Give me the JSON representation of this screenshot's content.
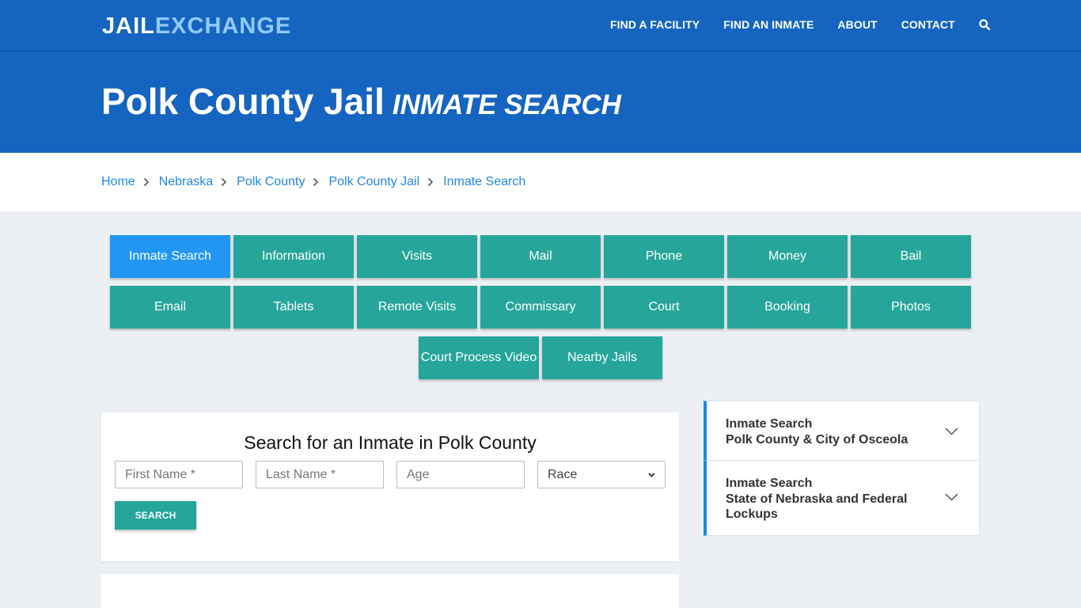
{
  "brand": {
    "logo_part1": "JAIL",
    "logo_part2": "EXCHANGE"
  },
  "nav": {
    "items": [
      "FIND A FACILITY",
      "FIND AN INMATE",
      "ABOUT",
      "CONTACT"
    ],
    "search_icon": "search-icon"
  },
  "hero": {
    "title": "Polk County Jail",
    "subtitle": "INMATE SEARCH"
  },
  "breadcrumb": [
    "Home",
    "Nebraska",
    "Polk County",
    "Polk County Jail",
    "Inmate Search"
  ],
  "tabs": {
    "row1": [
      "Inmate Search",
      "Information",
      "Visits",
      "Mail",
      "Phone",
      "Money",
      "Bail"
    ],
    "row2": [
      "Email",
      "Tablets",
      "Remote Visits",
      "Commissary",
      "Court",
      "Booking",
      "Photos"
    ],
    "row3": [
      "Court Process Video",
      "Nearby Jails"
    ],
    "active": "Inmate Search"
  },
  "search": {
    "heading": "Search for an Inmate in Polk County",
    "first_name_placeholder": "First Name *",
    "last_name_placeholder": "Last Name *",
    "age_placeholder": "Age",
    "race_selected": "Race",
    "button": "SEARCH"
  },
  "sidebar": {
    "items": [
      {
        "line1": "Inmate Search",
        "line2": "Polk County & City of Osceola"
      },
      {
        "line1": "Inmate Search",
        "line2": "State of Nebraska and Federal Lockups"
      }
    ]
  },
  "colors": {
    "header_blue": "#1565c0",
    "logo_accent": "#90caf9",
    "teal": "#26a69a",
    "active_blue": "#2196f3",
    "link_blue": "#1e88e5",
    "page_bg": "#ecf0f4"
  }
}
